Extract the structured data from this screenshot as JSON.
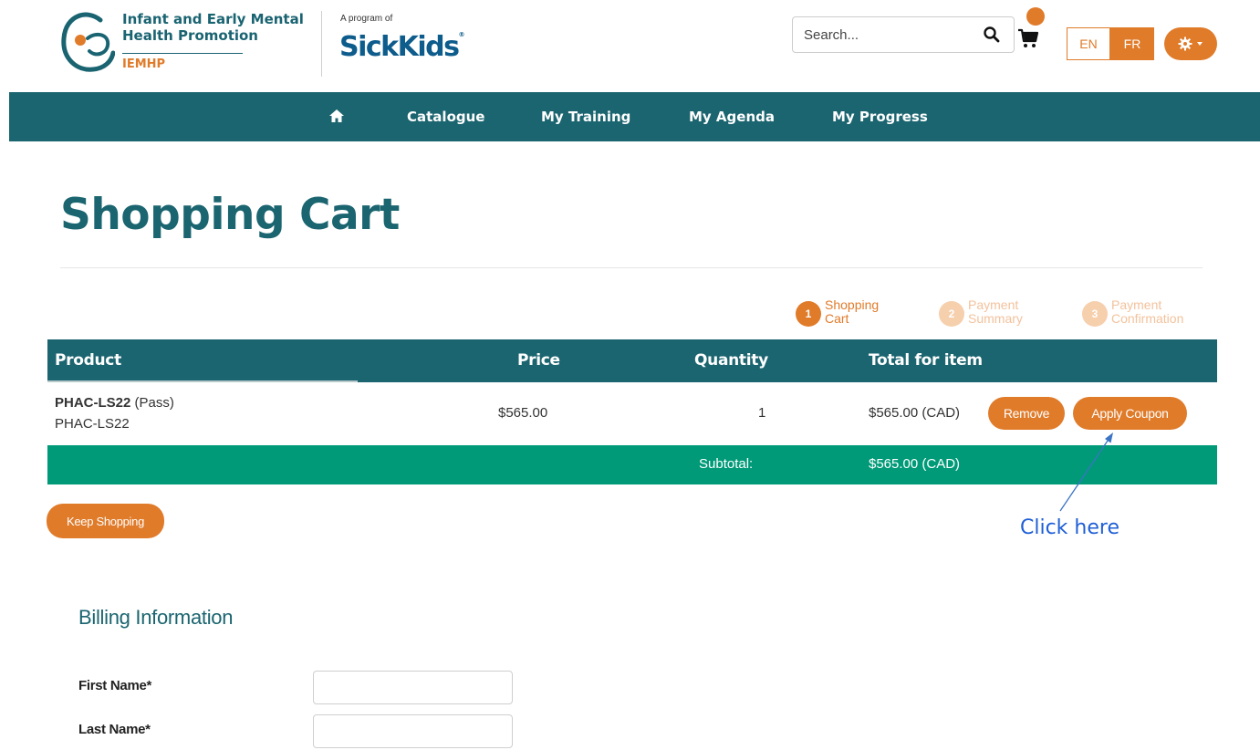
{
  "header": {
    "org_name_line1": "Infant and Early Mental",
    "org_name_line2": "Health Promotion",
    "org_abbr": "IEMHP",
    "program_of": "A program of",
    "brand_name": "SickKids",
    "brand_mark": "®",
    "search": {
      "placeholder": "Search..."
    },
    "lang": {
      "en": "EN",
      "fr": "FR",
      "active": "FR"
    },
    "accent_color": "#e07b2a",
    "icons": [
      "logo",
      "search-icon",
      "cart-icon",
      "gear-icon",
      "caret-down-icon"
    ]
  },
  "nav": {
    "home_icon": "home-icon",
    "items": [
      {
        "label": "Catalogue"
      },
      {
        "label": "My Training"
      },
      {
        "label": "My Agenda"
      },
      {
        "label": "My Progress"
      }
    ],
    "background_color": "#1b6570"
  },
  "page": {
    "title": "Shopping Cart"
  },
  "steps": [
    {
      "number": "1",
      "line1": "Shopping",
      "line2": "Cart",
      "active": true
    },
    {
      "number": "2",
      "line1": "Payment",
      "line2": "Summary",
      "active": false
    },
    {
      "number": "3",
      "line1": "Payment",
      "line2": "Confirmation",
      "active": false
    }
  ],
  "cart": {
    "columns": {
      "product": "Product",
      "price": "Price",
      "quantity": "Quantity",
      "total": "Total for item"
    },
    "items": [
      {
        "code": "PHAC-LS22",
        "variant": "(Pass)",
        "sub": "PHAC-LS22",
        "price": "$565.00",
        "quantity": "1",
        "total": "$565.00 (CAD)",
        "remove_label": "Remove",
        "coupon_label": "Apply Coupon"
      }
    ],
    "subtotal_label": "Subtotal:",
    "subtotal_value": "$565.00 (CAD)",
    "subtotal_color": "#009a78",
    "keep_shopping_label": "Keep Shopping"
  },
  "annotation": {
    "text": "Click here",
    "color": "#1f5fd6"
  },
  "billing": {
    "title": "Billing Information",
    "fields": [
      {
        "label": "First Name*",
        "value": ""
      },
      {
        "label": "Last Name*",
        "value": ""
      }
    ]
  }
}
